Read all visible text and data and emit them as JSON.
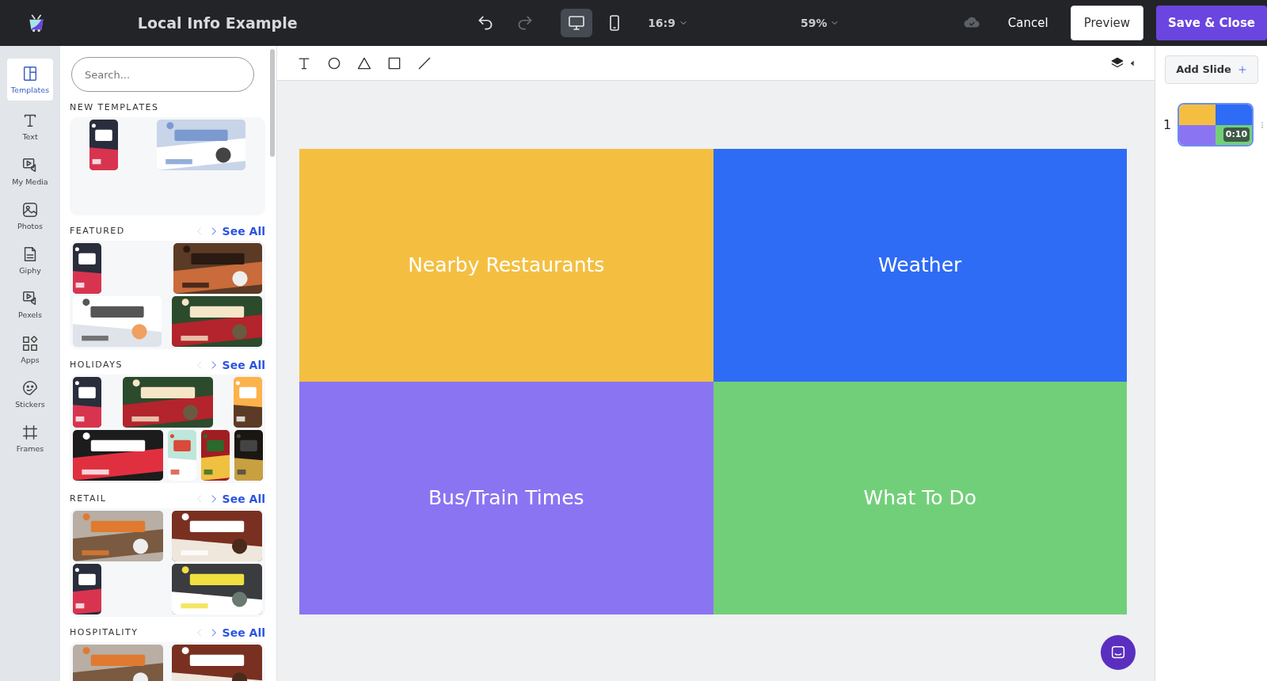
{
  "topbar": {
    "title": "Local Info Example",
    "redo_disabled": true,
    "devices": [
      {
        "kind": "desktop",
        "selected": true
      },
      {
        "kind": "mobile",
        "selected": false
      }
    ],
    "aspect": "16:9",
    "zoom": "59%",
    "cancel": "Cancel",
    "preview": "Preview",
    "save": "Save & Close"
  },
  "rail": [
    {
      "kind": "templates",
      "label": "Templates",
      "selected": true
    },
    {
      "kind": "text",
      "label": "Text",
      "selected": false
    },
    {
      "kind": "media",
      "label": "My Media",
      "selected": false
    },
    {
      "kind": "photos",
      "label": "Photos",
      "selected": false
    },
    {
      "kind": "gif",
      "label": "Giphy",
      "selected": false
    },
    {
      "kind": "media",
      "label": "Pexels",
      "selected": false
    },
    {
      "kind": "apps",
      "label": "Apps",
      "selected": false
    },
    {
      "kind": "stickers",
      "label": "Stickers",
      "selected": false
    },
    {
      "kind": "frames",
      "label": "Frames",
      "selected": false
    }
  ],
  "search": {
    "placeholder": "Search..."
  },
  "sections": [
    {
      "title": "NEW TEMPLATES"
    },
    {
      "title": "FEATURED",
      "see_all": "See All"
    },
    {
      "title": "HOLIDAYS",
      "see_all": "See All"
    },
    {
      "title": "RETAIL",
      "see_all": "See All"
    },
    {
      "title": "HOSPITALITY",
      "see_all": "See All"
    }
  ],
  "slide": {
    "tiles": [
      {
        "label": "Nearby Restaurants",
        "color": "#f4bf41"
      },
      {
        "label": "Weather",
        "color": "#2f6cf5"
      },
      {
        "label": "Bus/Train Times",
        "color": "#8b74f2"
      },
      {
        "label": "What To Do",
        "color": "#72cf79"
      }
    ]
  },
  "slides_panel": {
    "add_slide": "Add Slide",
    "slides": [
      {
        "number": "1",
        "duration": "0:10",
        "selected": true
      }
    ]
  }
}
